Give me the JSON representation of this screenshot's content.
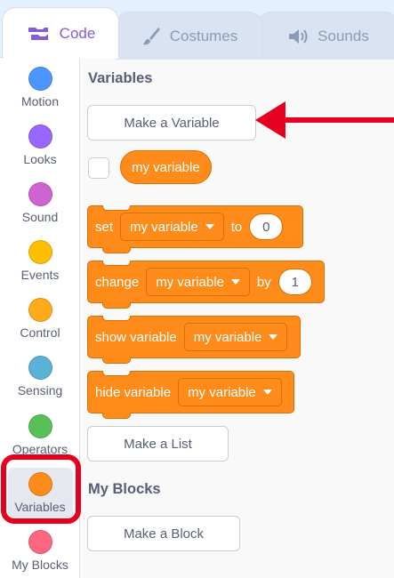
{
  "tabs": [
    {
      "label": "Code",
      "icon": "code-icon",
      "active": true
    },
    {
      "label": "Costumes",
      "icon": "brush-icon",
      "active": false
    },
    {
      "label": "Sounds",
      "icon": "speaker-icon",
      "active": false
    }
  ],
  "categories": [
    {
      "label": "Motion",
      "color": "#4c97ff"
    },
    {
      "label": "Looks",
      "color": "#9966ff"
    },
    {
      "label": "Sound",
      "color": "#cf63cf"
    },
    {
      "label": "Events",
      "color": "#ffbf00"
    },
    {
      "label": "Control",
      "color": "#ffab19"
    },
    {
      "label": "Sensing",
      "color": "#5cb1d6"
    },
    {
      "label": "Operators",
      "color": "#59c059"
    },
    {
      "label": "Variables",
      "color": "#ff8c1a",
      "selected": true
    },
    {
      "label": "My Blocks",
      "color": "#ff6680"
    }
  ],
  "flyout": {
    "variables_title": "Variables",
    "make_variable": "Make a Variable",
    "variable_name": "my variable",
    "blocks": {
      "set": {
        "label": "set",
        "dropdown": "my variable",
        "to": "to",
        "value": "0"
      },
      "change": {
        "label": "change",
        "dropdown": "my variable",
        "by": "by",
        "value": "1"
      },
      "show": {
        "label": "show variable",
        "dropdown": "my variable"
      },
      "hide": {
        "label": "hide variable",
        "dropdown": "my variable"
      }
    },
    "make_list": "Make a List",
    "my_blocks_title": "My Blocks",
    "make_block": "Make a Block"
  },
  "colors": {
    "accent": "#855cd6",
    "variables_block": "#ff8c1a",
    "annotation_red": "#e6001f"
  }
}
